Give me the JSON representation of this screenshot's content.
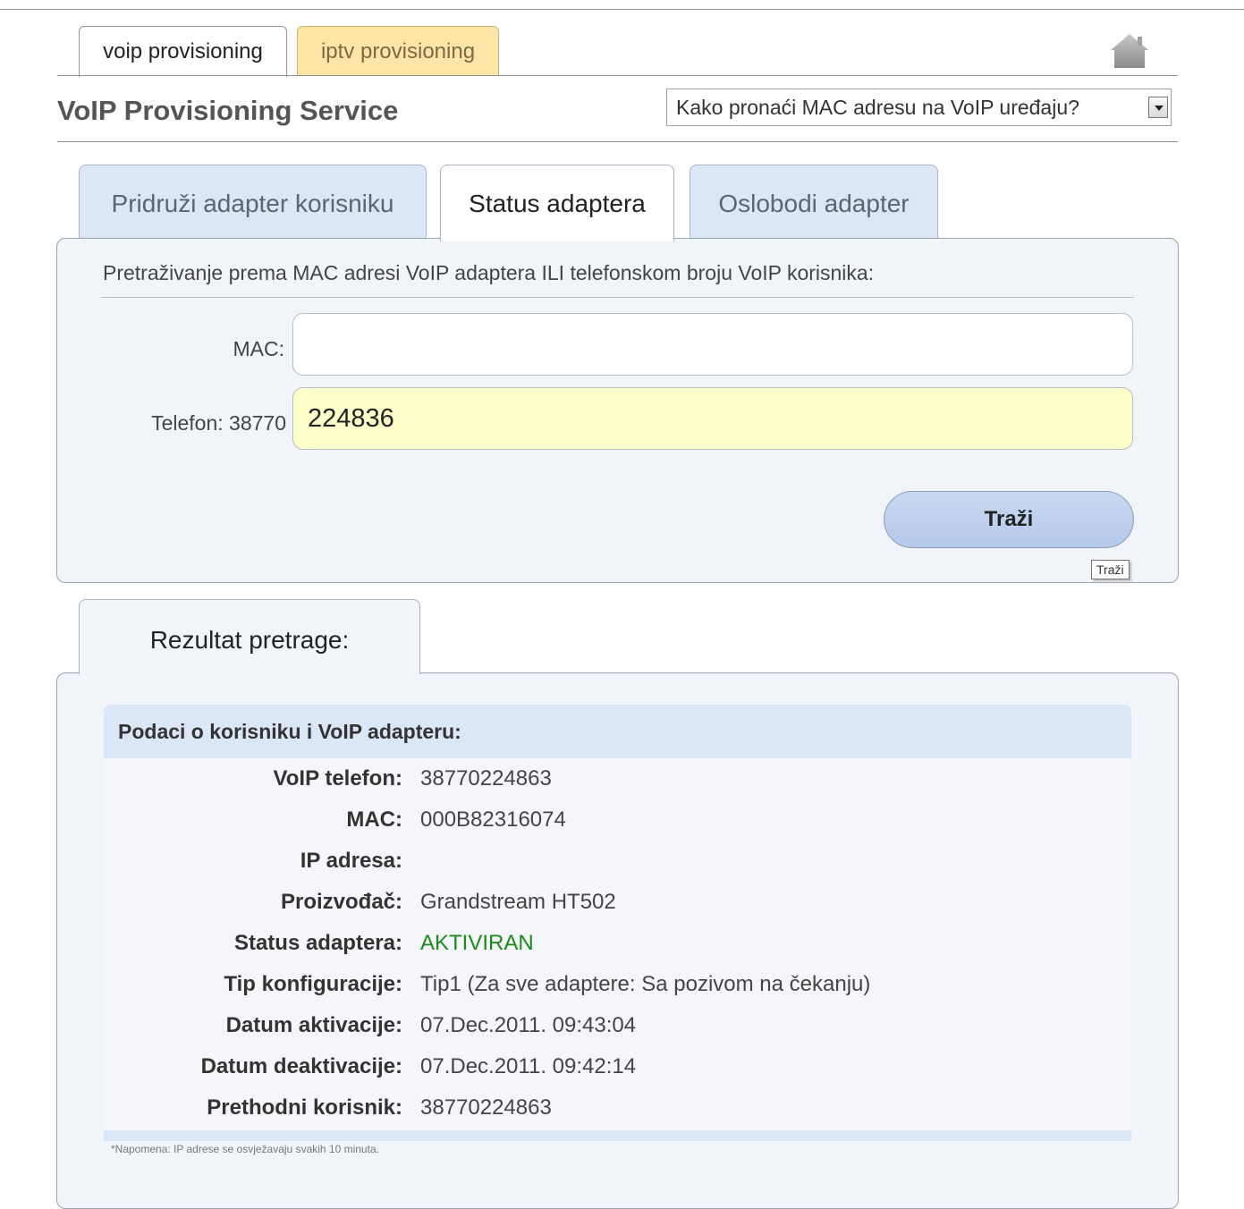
{
  "top_tabs": [
    {
      "label": "voip provisioning",
      "active": true
    },
    {
      "label": "iptv provisioning",
      "active": false
    }
  ],
  "header": {
    "title": "VoIP Provisioning Service",
    "help_select": "Kako pronaći MAC adresu na VoIP uređaju?"
  },
  "panel_tabs": [
    {
      "label": "Pridruži adapter korisniku",
      "active": false
    },
    {
      "label": "Status adaptera",
      "active": true
    },
    {
      "label": "Oslobodi adapter",
      "active": false
    }
  ],
  "search": {
    "heading": "Pretraživanje prema MAC adresi VoIP adaptera ILI telefonskom broju VoIP korisnika:",
    "mac_label": "MAC:",
    "mac_value": "",
    "phone_label": "Telefon: 38770",
    "phone_value": "224836",
    "button_label": "Traži",
    "tooltip": "Traži"
  },
  "result": {
    "tab_label": "Rezultat pretrage:",
    "heading": "Podaci o korisniku i VoIP adapteru:",
    "rows": [
      {
        "key": "VoIP telefon:",
        "value": "38770224863"
      },
      {
        "key": "MAC:",
        "value": "000B82316074"
      },
      {
        "key": "IP adresa:",
        "value": ""
      },
      {
        "key": "Proizvođač:",
        "value": "Grandstream HT502"
      },
      {
        "key": "Status adaptera:",
        "value": "AKTIVIRAN"
      },
      {
        "key": "Tip konfiguracije:",
        "value": "Tip1 (Za sve adaptere: Sa pozivom na čekanju)"
      },
      {
        "key": "Datum aktivacije:",
        "value": "07.Dec.2011. 09:43:04"
      },
      {
        "key": "Datum deaktivacije:",
        "value": "07.Dec.2011. 09:42:14"
      },
      {
        "key": "Prethodni korisnik:",
        "value": "38770224863"
      }
    ],
    "note": "*Napomena: IP adrese se osvježavaju svakih 10 minuta."
  },
  "colors": {
    "tab_inactive_bg": "#dbe6f7",
    "iptv_tab_bg": "#fde5a8",
    "active_field_bg": "#ffffcc",
    "status_active": "#1a8a1a"
  },
  "icons": {
    "home": "home-icon"
  }
}
